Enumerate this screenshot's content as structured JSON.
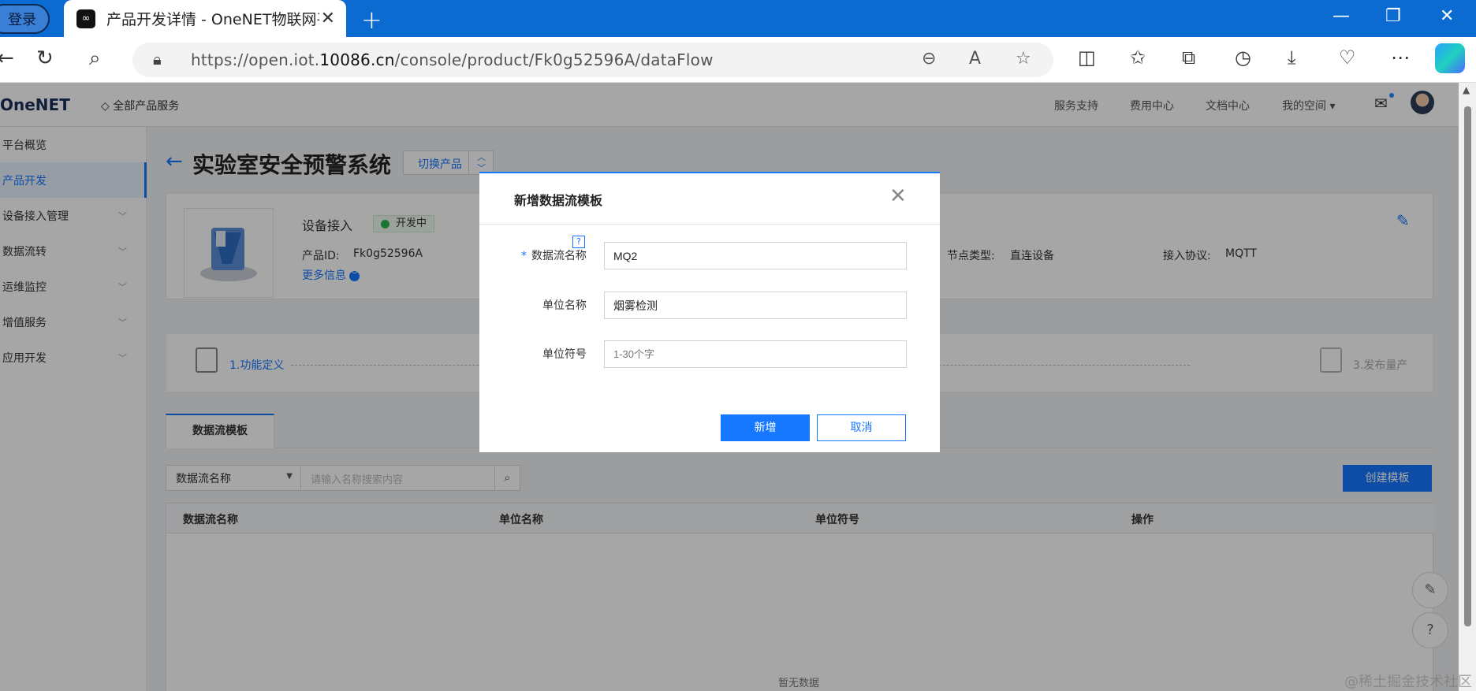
{
  "browser": {
    "login_label": "登录",
    "tab_title": "产品开发详情 - OneNET物联网平台",
    "url_prefix": "https://open.iot.",
    "url_host": "10086.cn",
    "url_path": "/console/product/Fk0g52596A/dataFlow",
    "accent": "#0c6bd0"
  },
  "topnav": {
    "logo": "OneNET",
    "all_products": "全部产品服务",
    "links": [
      "服务支持",
      "费用中心",
      "文档中心",
      "我的空间"
    ]
  },
  "sidebar": {
    "items": [
      {
        "label": "平台概览"
      },
      {
        "label": "产品开发"
      },
      {
        "label": "设备接入管理"
      },
      {
        "label": "数据流转"
      },
      {
        "label": "运维监控"
      },
      {
        "label": "增值服务"
      },
      {
        "label": "应用开发"
      }
    ]
  },
  "product": {
    "title": "实验室安全预警系统",
    "switch_label": "切换产品",
    "access_label": "设备接入",
    "status": "开发中",
    "id_label": "产品ID:",
    "id_value": "Fk0g52596A",
    "more_info": "更多信息",
    "node_label": "节点类型:",
    "node_value": "直连设备",
    "protocol_label": "接入协议:",
    "protocol_value": "MQTT"
  },
  "steps": {
    "step1": "1.功能定义",
    "step3": "3.发布量产"
  },
  "tabs": {
    "active": "数据流模板"
  },
  "filter": {
    "select_value": "数据流名称",
    "search_placeholder": "请输入名称搜索内容",
    "create_button": "创建模板"
  },
  "table": {
    "headers": [
      "数据流名称",
      "单位名称",
      "单位符号",
      "操作"
    ],
    "empty_text": "暂无数据"
  },
  "modal": {
    "title": "新增数据流模板",
    "fields": [
      {
        "label": "数据流名称",
        "required": "*",
        "value": "MQ2",
        "placeholder": ""
      },
      {
        "label": "单位名称",
        "value": "烟雾检测",
        "placeholder": ""
      },
      {
        "label": "单位符号",
        "value": "",
        "placeholder": "1-30个字"
      }
    ],
    "ok_label": "新增",
    "cancel_label": "取消"
  },
  "watermark": "@稀土掘金技术社区"
}
